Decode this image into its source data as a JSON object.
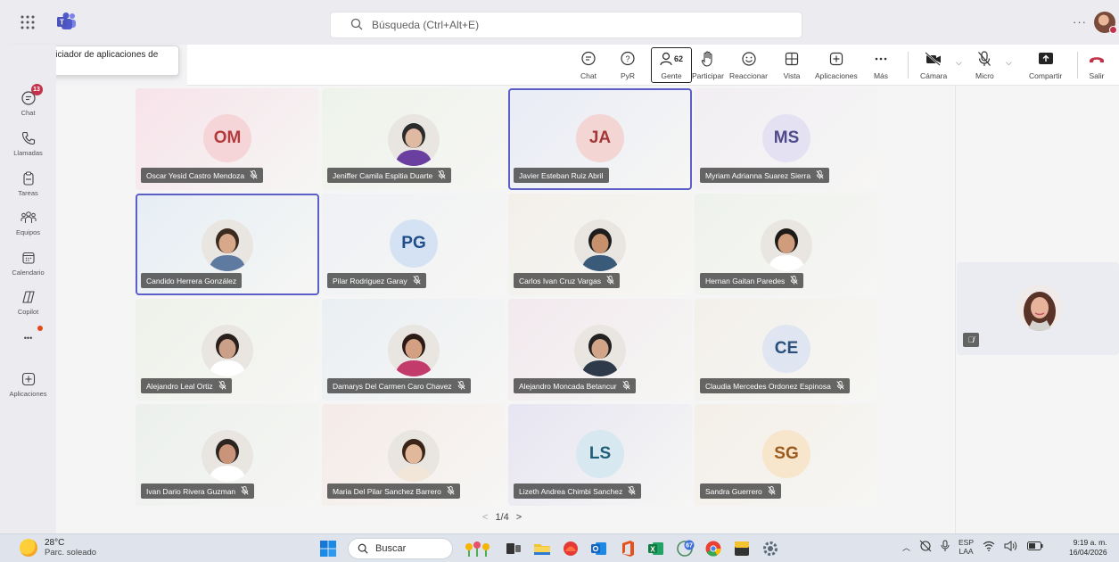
{
  "search": {
    "placeholder": "Búsqueda (Ctrl+Alt+E)"
  },
  "tooltip": {
    "text": "Abrir el iniciador de aplicaciones de Office"
  },
  "toolbar": {
    "chat": "Chat",
    "pyr": "PyR",
    "people": "Gente",
    "people_count": "62",
    "raise": "Participar",
    "react": "Reaccionar",
    "view": "Vista",
    "apps": "Aplicaciones",
    "more": "Más",
    "camera": "Cámara",
    "mic": "Micro",
    "share": "Compartir",
    "leave": "Salir"
  },
  "rail": {
    "chat": "Chat",
    "chat_badge": "13",
    "calls": "Llamadas",
    "tasks": "Tareas",
    "teams": "Equipos",
    "calendar": "Calendario",
    "copilot": "Copilot",
    "more": "•••",
    "apps": "Aplicaciones"
  },
  "participants": [
    {
      "name": "Oscar Yesid Castro Mendoza",
      "initials": "OM",
      "bg": "#f7e3ea",
      "circle": "#f6d5d8",
      "fg": "#b33a3a"
    },
    {
      "name": "Jeniffer Camila Espitia Duarte",
      "initials": "",
      "bg": "#eef3ea"
    },
    {
      "name": "Javier Esteban Ruiz Abril",
      "initials": "JA",
      "bg": "#e9ecf6",
      "circle": "#f3d6d4",
      "fg": "#a33838",
      "speaking": true
    },
    {
      "name": "Myriam Adrianna Suarez Sierra",
      "initials": "MS",
      "bg": "#f2eef3",
      "circle": "#e4e1f2",
      "fg": "#4f4a8a"
    },
    {
      "name": "Candido Herrera González",
      "initials": "",
      "bg": "#e6eef5",
      "speaking": true
    },
    {
      "name": "Pilar Rodriguez Garay",
      "initials": "PG",
      "bg": "#eff1f5",
      "circle": "#d5e2f3",
      "fg": "#1f4e8a"
    },
    {
      "name": "Carlos Ivan Cruz Vargas",
      "initials": "",
      "bg": "#f3f0ea"
    },
    {
      "name": "Hernan Gaitan Paredes",
      "initials": "",
      "bg": "#eef2ec"
    },
    {
      "name": "Alejandro Leal Ortiz",
      "initials": "",
      "bg": "#eef2ea"
    },
    {
      "name": "Damarys Del Carmen Caro Chavez",
      "initials": "",
      "bg": "#eaeff3"
    },
    {
      "name": "Alejandro Moncada Betancur",
      "initials": "",
      "bg": "#f2e9ee"
    },
    {
      "name": "Claudia Mercedes Ordonez Espinosa",
      "initials": "CE",
      "bg": "#f3f0ea",
      "circle": "#dfe6f1",
      "fg": "#2a4f7a"
    },
    {
      "name": "Ivan Dario Rivera Guzman",
      "initials": "",
      "bg": "#ecf0ec"
    },
    {
      "name": "Maria Del Pilar Sanchez Barrero",
      "initials": "",
      "bg": "#f5ebe8"
    },
    {
      "name": "Lizeth Andrea Chimbi Sanchez",
      "initials": "LS",
      "bg": "#e7e5f2",
      "circle": "#d7e8f0",
      "fg": "#1f5e78"
    },
    {
      "name": "Sandra Guerrero",
      "initials": "SG",
      "bg": "#f4efe8",
      "circle": "#f7e5cc",
      "fg": "#9a5b1c"
    }
  ],
  "pager": {
    "text": "1/4"
  },
  "taskbar": {
    "temp": "28°C",
    "weather": "Parc. soleado",
    "search": "Buscar",
    "teams_badge": "67",
    "lang1": "ESP",
    "lang2": "LAA",
    "time": "9:19 a. m.",
    "date": "16/04/2026"
  }
}
